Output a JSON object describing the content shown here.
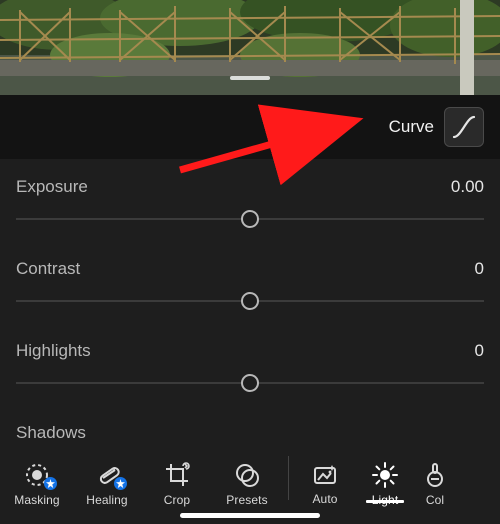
{
  "curve": {
    "label": "Curve"
  },
  "sliders": [
    {
      "name": "Exposure",
      "value": "0.00"
    },
    {
      "name": "Contrast",
      "value": "0"
    },
    {
      "name": "Highlights",
      "value": "0"
    },
    {
      "name": "Shadows",
      "value": ""
    }
  ],
  "toolbar": {
    "items": [
      {
        "label": "Masking"
      },
      {
        "label": "Healing"
      },
      {
        "label": "Crop"
      },
      {
        "label": "Presets"
      },
      {
        "label": "Auto"
      },
      {
        "label": "Light"
      },
      {
        "label": "Col"
      }
    ],
    "active_index": 5
  },
  "colors": {
    "accent": "#1473e6",
    "arrow": "#ff1a1a"
  }
}
